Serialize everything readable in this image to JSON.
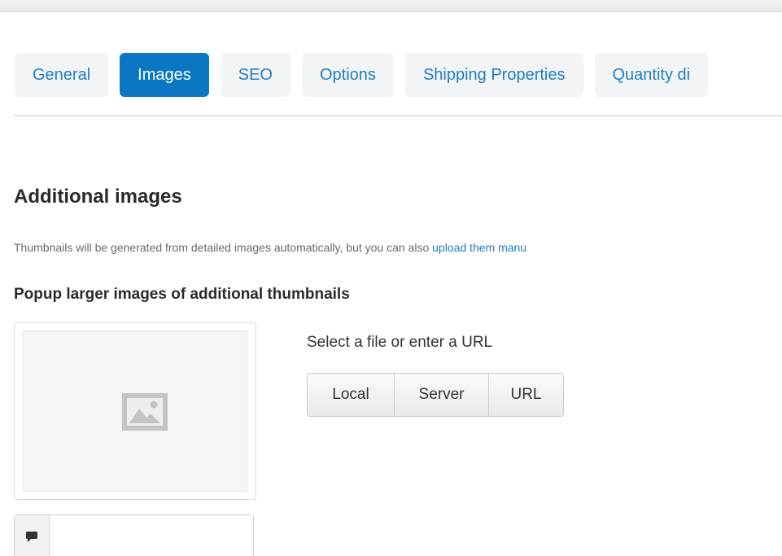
{
  "tabs": [
    {
      "label": "General",
      "active": false
    },
    {
      "label": "Images",
      "active": true
    },
    {
      "label": "SEO",
      "active": false
    },
    {
      "label": "Options",
      "active": false
    },
    {
      "label": "Shipping Properties",
      "active": false
    },
    {
      "label": "Quantity di",
      "active": false
    }
  ],
  "section": {
    "title": "Additional images",
    "help_text": "Thumbnails will be generated from detailed images automatically, but you can also ",
    "help_link": "upload them manu",
    "setting_label": "Popup larger images of additional thumbnails"
  },
  "image": {
    "placeholder_icon": "image-placeholder-icon",
    "alt_icon": "comment-icon",
    "alt_value": ""
  },
  "uploader": {
    "caption": "Select a file or enter a URL",
    "buttons": {
      "local": "Local",
      "server": "Server",
      "url": "URL"
    }
  },
  "colors": {
    "accent": "#0b77c4",
    "link": "#1f7fc3",
    "tab_bg": "#f3f4f5"
  }
}
